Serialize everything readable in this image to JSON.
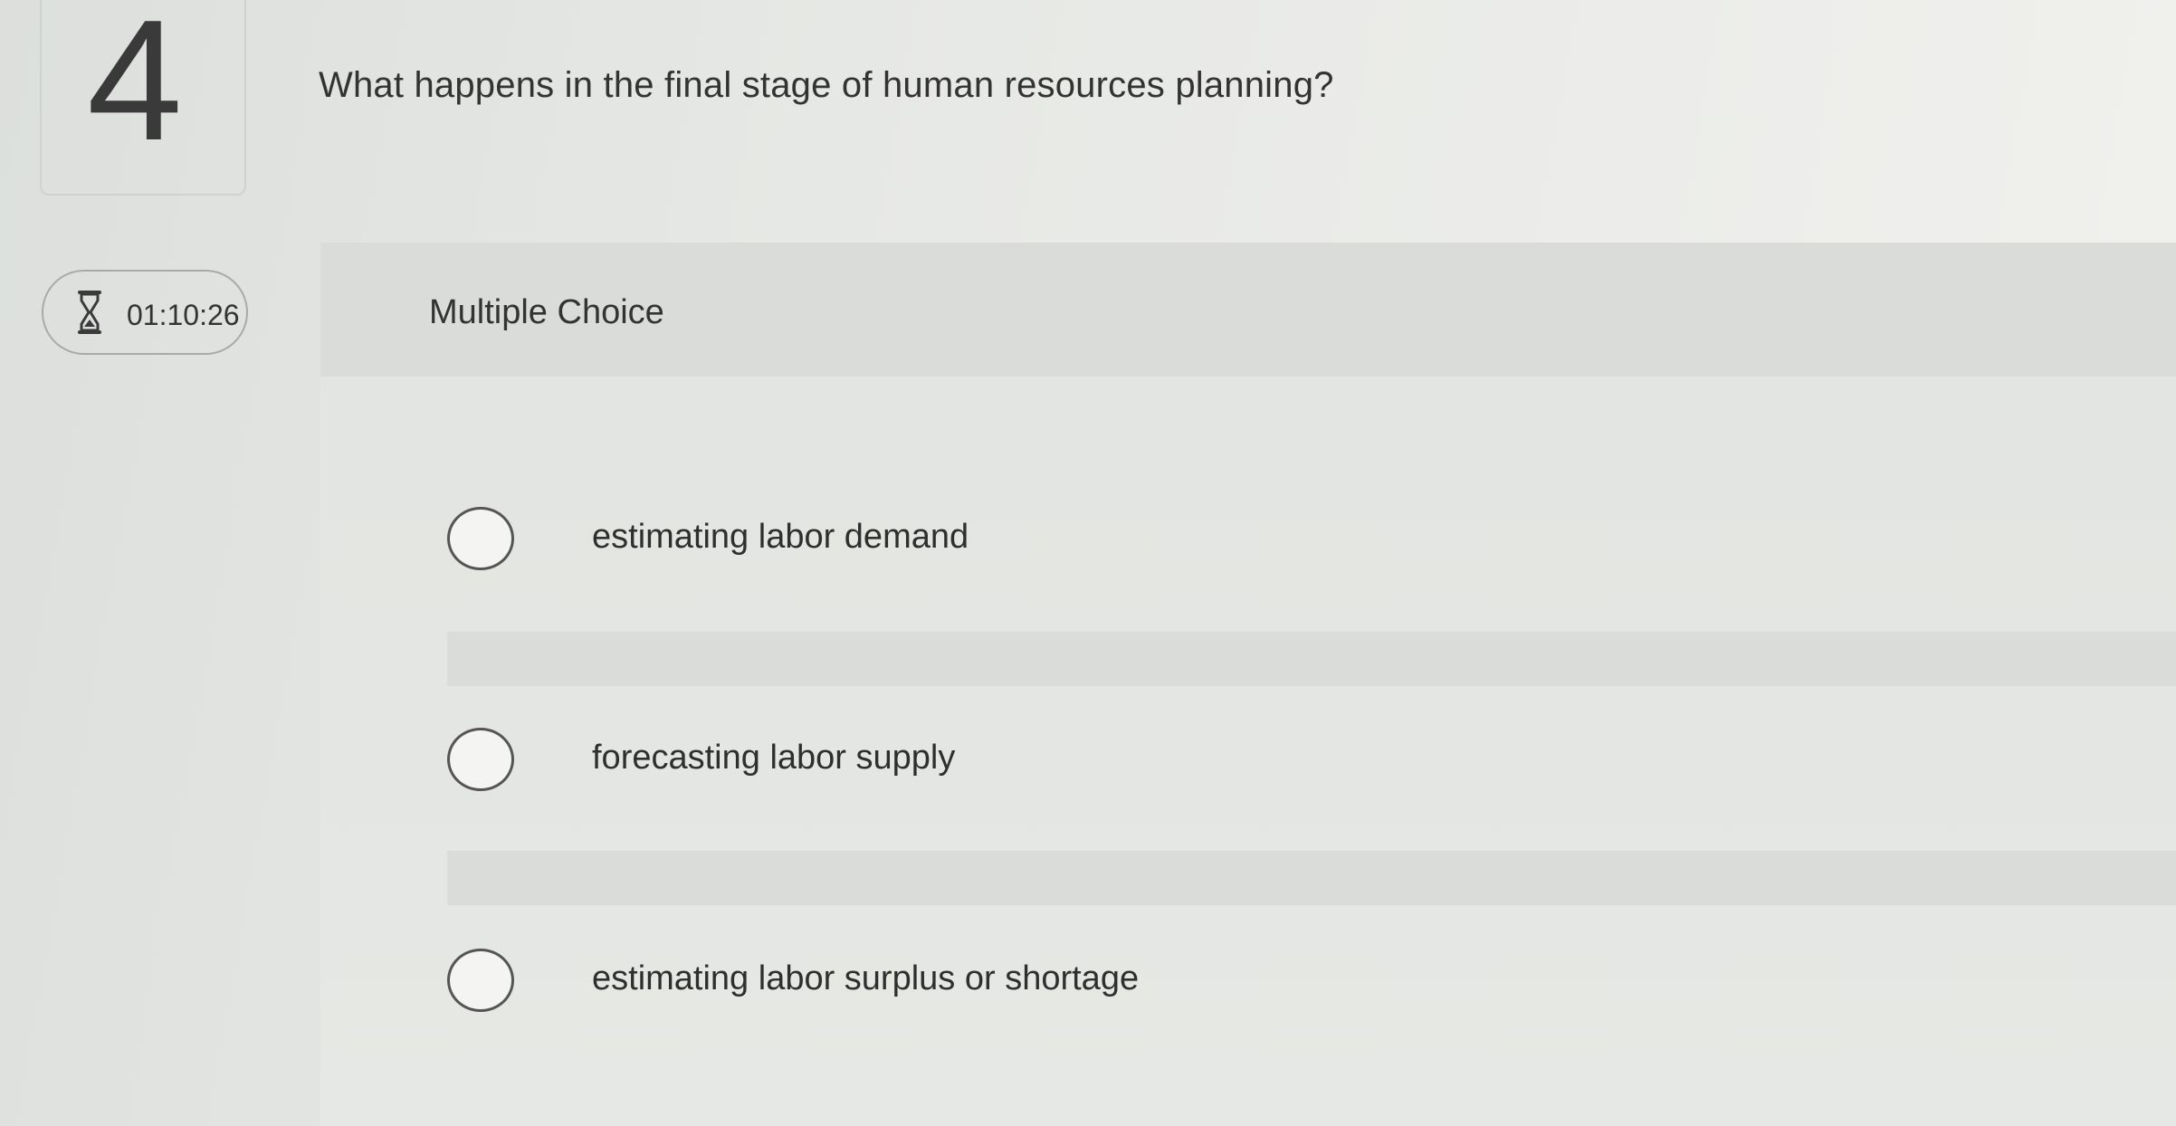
{
  "question": {
    "number": "4",
    "text": "What happens in the final stage of human resources planning?"
  },
  "timer": {
    "icon": "hourglass-icon",
    "value": "01:10:26"
  },
  "answer_panel": {
    "label": "Multiple Choice",
    "options": [
      {
        "label": "estimating labor demand",
        "selected": false
      },
      {
        "label": "forecasting labor supply",
        "selected": false
      },
      {
        "label": "estimating labor surplus or shortage",
        "selected": false
      }
    ]
  }
}
